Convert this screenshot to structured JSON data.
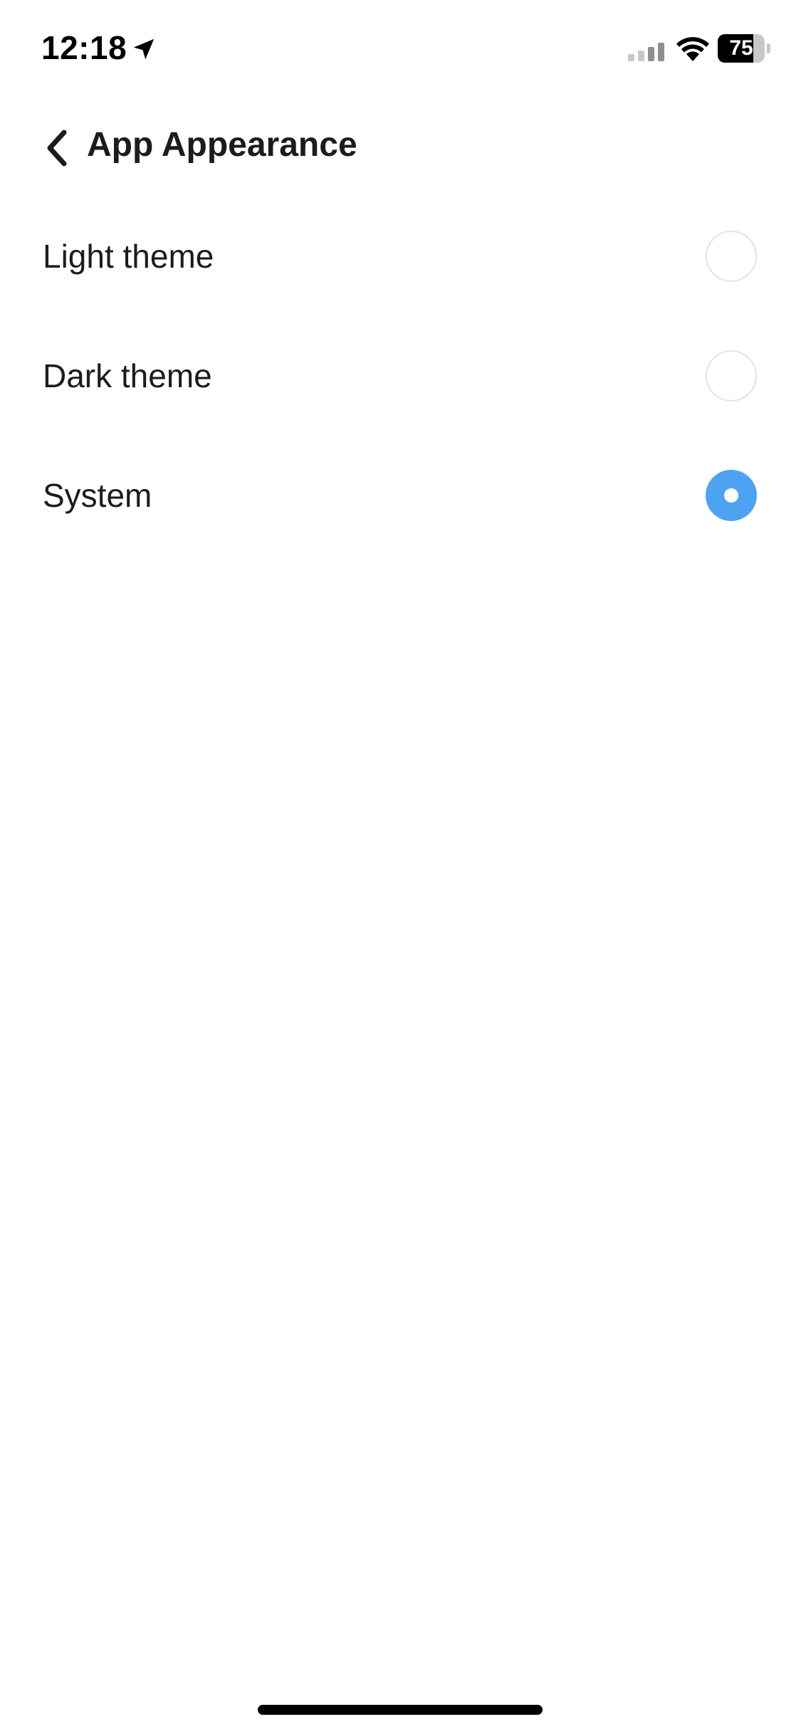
{
  "status_bar": {
    "time": "12:18",
    "battery_percent": "75",
    "battery_level": 0.75,
    "icons": [
      "location-arrow-icon",
      "cellular-signal-icon",
      "wifi-icon",
      "battery-icon"
    ]
  },
  "header": {
    "title": "App Appearance",
    "back_icon": "chevron-left-icon"
  },
  "theme_options": [
    {
      "label": "Light theme",
      "selected": false
    },
    {
      "label": "Dark theme",
      "selected": false
    },
    {
      "label": "System",
      "selected": true
    }
  ],
  "colors": {
    "accent": "#4da3f2",
    "text": "#1c1c1e",
    "radio_border": "#e3e3e6",
    "background": "#ffffff"
  }
}
